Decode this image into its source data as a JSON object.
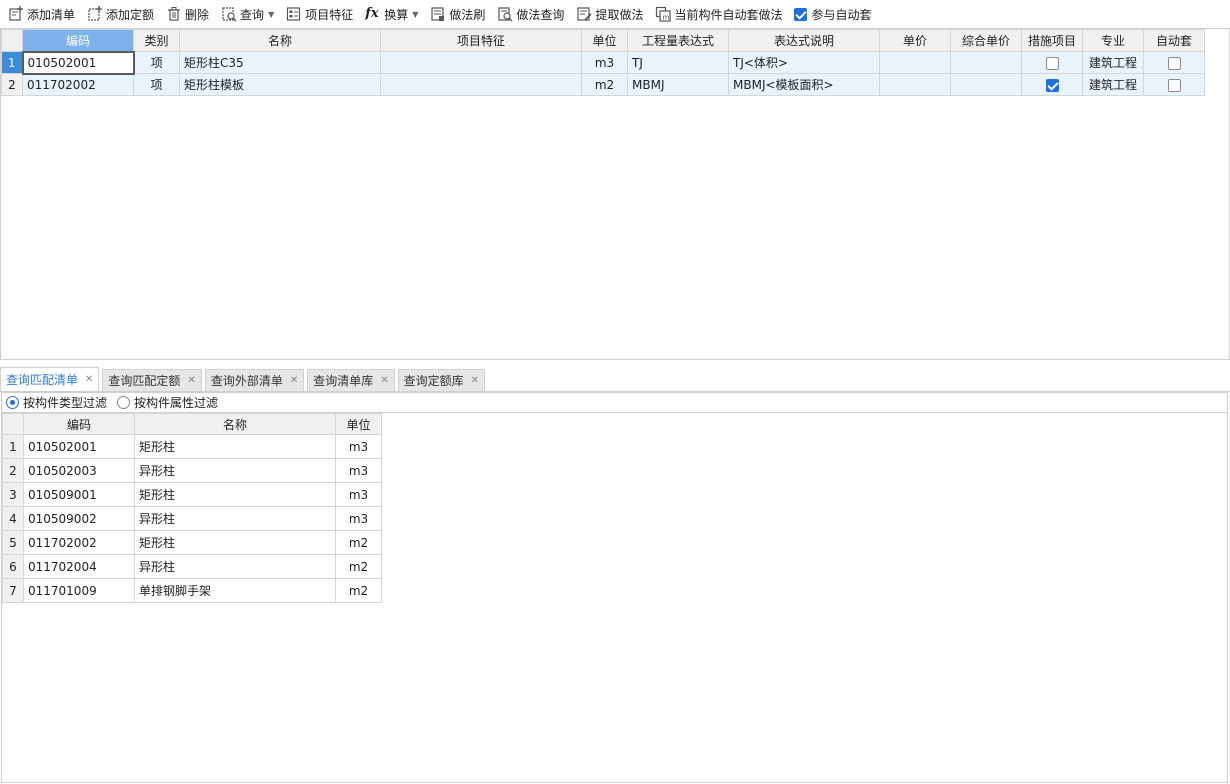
{
  "toolbar": {
    "items": [
      {
        "label": "添加清单",
        "icon": "add-list-icon"
      },
      {
        "label": "添加定额",
        "icon": "add-quota-icon"
      },
      {
        "label": "删除",
        "icon": "trash-icon"
      },
      {
        "label": "查询",
        "icon": "query-icon"
      },
      {
        "label": "项目特征",
        "icon": "feature-icon"
      },
      {
        "label": "换算",
        "icon": "fx-icon"
      },
      {
        "label": "做法刷",
        "icon": "brush-icon"
      },
      {
        "label": "做法查询",
        "icon": "method-query-icon"
      },
      {
        "label": "提取做法",
        "icon": "extract-icon"
      },
      {
        "label": "当前构件自动套做法",
        "icon": "auto-apply-icon"
      }
    ],
    "auto_checkbox_label": "参与自动套"
  },
  "upper_table": {
    "headers": [
      "编码",
      "类别",
      "名称",
      "项目特征",
      "单位",
      "工程量表达式",
      "表达式说明",
      "单价",
      "综合单价",
      "措施项目",
      "专业",
      "自动套"
    ],
    "rows": [
      {
        "num": "1",
        "code": "010502001",
        "type": "项",
        "name": "矩形柱C35",
        "feature": "",
        "unit": "m3",
        "expr": "TJ",
        "expr_desc": "TJ<体积>",
        "price": "",
        "total_price": "",
        "measure": false,
        "major": "建筑工程",
        "auto": false
      },
      {
        "num": "2",
        "code": "011702002",
        "type": "项",
        "name": "矩形柱模板",
        "feature": "",
        "unit": "m2",
        "expr": "MBMJ",
        "expr_desc": "MBMJ<模板面积>",
        "price": "",
        "total_price": "",
        "measure": true,
        "major": "建筑工程",
        "auto": false
      }
    ]
  },
  "tabs": [
    {
      "label": "查询匹配清单",
      "active": true
    },
    {
      "label": "查询匹配定额",
      "active": false
    },
    {
      "label": "查询外部清单",
      "active": false
    },
    {
      "label": "查询清单库",
      "active": false
    },
    {
      "label": "查询定额库",
      "active": false
    }
  ],
  "filters": {
    "by_type": "按构件类型过滤",
    "by_attr": "按构件属性过滤",
    "selected": "by_type"
  },
  "lower_table": {
    "headers": [
      "编码",
      "名称",
      "单位"
    ],
    "rows": [
      {
        "num": "1",
        "code": "010502001",
        "name": "矩形柱",
        "unit": "m3"
      },
      {
        "num": "2",
        "code": "010502003",
        "name": "异形柱",
        "unit": "m3"
      },
      {
        "num": "3",
        "code": "010509001",
        "name": "矩形柱",
        "unit": "m3"
      },
      {
        "num": "4",
        "code": "010509002",
        "name": "异形柱",
        "unit": "m3"
      },
      {
        "num": "5",
        "code": "011702002",
        "name": "矩形柱",
        "unit": "m2"
      },
      {
        "num": "6",
        "code": "011702004",
        "name": "异形柱",
        "unit": "m2"
      },
      {
        "num": "7",
        "code": "011701009",
        "name": "单排钢脚手架",
        "unit": "m2"
      }
    ]
  },
  "colors": {
    "accent": "#1e6fd9",
    "header_highlight": "#7db1e9",
    "row_bg": "#e8f3fc",
    "row_selected": "#3d8ad8",
    "active_tab_text": "#2f7dd1"
  }
}
